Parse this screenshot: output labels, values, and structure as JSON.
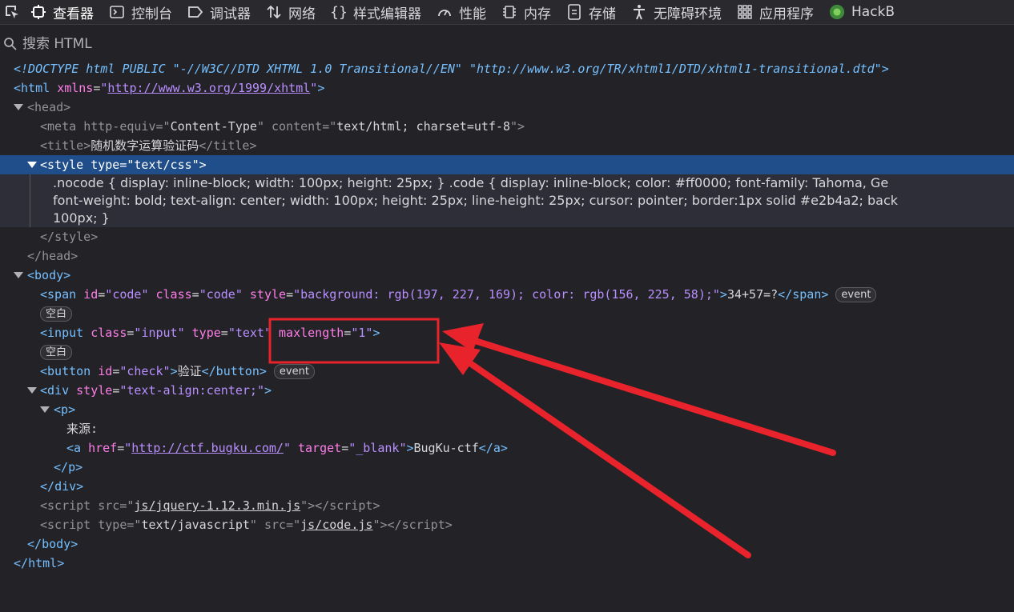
{
  "toolbar": {
    "tabs": [
      {
        "label": "查看器",
        "icon": "inspector-icon",
        "active": true
      },
      {
        "label": "控制台",
        "icon": "console-icon"
      },
      {
        "label": "调试器",
        "icon": "debugger-icon"
      },
      {
        "label": "网络",
        "icon": "network-icon"
      },
      {
        "label": "样式编辑器",
        "icon": "style-editor-icon"
      },
      {
        "label": "性能",
        "icon": "performance-icon"
      },
      {
        "label": "内存",
        "icon": "memory-icon"
      },
      {
        "label": "存储",
        "icon": "storage-icon"
      },
      {
        "label": "无障碍环境",
        "icon": "accessibility-icon"
      },
      {
        "label": "应用程序",
        "icon": "application-icon"
      },
      {
        "label": "HackB",
        "icon": "hackbar-icon"
      }
    ]
  },
  "search": {
    "placeholder": "搜索 HTML"
  },
  "tree": {
    "doctype": "<!DOCTYPE html PUBLIC \"-//W3C//DTD XHTML 1.0 Transitional//EN\" \"http://www.w3.org/TR/xhtml1/DTD/xhtml1-transitional.dtd\">",
    "html": {
      "tag": "html",
      "attr": "xmlns",
      "val": "http://www.w3.org/1999/xhtml"
    },
    "head": "head",
    "meta": {
      "tag": "meta",
      "a1": "http-equiv",
      "v1": "Content-Type",
      "a2": "content",
      "v2": "text/html; charset=utf-8"
    },
    "title": {
      "tag": "title",
      "text": "随机数字运算验证码"
    },
    "style": {
      "tag": "style",
      "attr": "type",
      "val": "text/css"
    },
    "css": [
      ".nocode { display: inline-block; width: 100px; height: 25px; } .code { display: inline-block; color: #ff0000; font-family: Tahoma, Ge",
      "font-weight: bold; text-align: center; width: 100px; height: 25px; line-height: 25px; cursor: pointer; border:1px solid #e2b4a2; back",
      "100px; }"
    ],
    "style_close": "style",
    "head_close": "head",
    "body": "body",
    "span": {
      "tag": "span",
      "a1": "id",
      "v1": "code",
      "a2": "class",
      "v2": "code",
      "a3": "style",
      "v3": "background: rgb(197, 227, 169); color: rgb(156, 225, 58);",
      "text": "34+57=?"
    },
    "event_label": "event",
    "whitespace_label": "空白",
    "input": {
      "tag": "input",
      "a1": "class",
      "v1": "input",
      "a2": "type",
      "v2": "text",
      "a3": "maxlength",
      "v3": "1"
    },
    "button": {
      "tag": "button",
      "a1": "id",
      "v1": "check",
      "text": "验证"
    },
    "div": {
      "tag": "div",
      "attr": "style",
      "val": "text-align:center;"
    },
    "p": {
      "tag": "p",
      "text": "来源:"
    },
    "a": {
      "tag": "a",
      "a1": "href",
      "v1": "http://ctf.bugku.com/",
      "a2": "target",
      "v2": "_blank",
      "text": "BugKu-ctf"
    },
    "script1": {
      "tag": "script",
      "attr": "src",
      "val": "js/jquery-1.12.3.min.js"
    },
    "script2": {
      "tag": "script",
      "a1": "type",
      "v1": "text/javascript",
      "a2": "src",
      "v2": "js/code.js"
    }
  },
  "colors": {
    "annotation_red": "#e8232b",
    "selection": "#204e8a"
  }
}
